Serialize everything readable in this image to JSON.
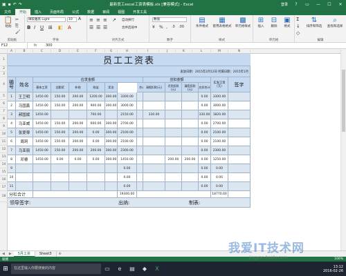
{
  "window": {
    "title": "最新员工excel工资表模板.xls [兼容模式] - Excel",
    "user": "登录",
    "buttons": [
      "?",
      "▭",
      "—",
      "☐",
      "✕"
    ]
  },
  "ribbon_tabs": [
    "文件",
    "开始",
    "插入",
    "页面布局",
    "公式",
    "数据",
    "审阅",
    "视图",
    "开发工具"
  ],
  "ribbon": {
    "font_name": "微软雅黑 Light",
    "font_size": "10",
    "number_format": "数值",
    "groups": [
      "剪贴板",
      "字体",
      "对齐方式",
      "数字",
      "样式",
      "单元格",
      "编辑"
    ],
    "buttons": {
      "paste": "粘贴",
      "wrap": "自动换行",
      "merge": "合并后居中",
      "cond_format": "条件格式",
      "as_table": "套用表格格式",
      "cell_style": "单元格样式",
      "insert": "插入",
      "delete": "删除",
      "format": "格式",
      "sort": "排序和筛选",
      "find": "查找和选择"
    }
  },
  "formula_bar": {
    "name_box": "F12",
    "fx": "fx",
    "value": "300"
  },
  "columns": [
    "A",
    "B",
    "C",
    "D",
    "E",
    "F",
    "G",
    "H",
    "I",
    "J",
    "K",
    "L",
    "M",
    "N"
  ],
  "rows": [
    "1",
    "2",
    "3",
    "4",
    "5",
    "6",
    "7",
    "8",
    "9",
    "10",
    "11",
    "12",
    "13",
    "14",
    "15",
    "16",
    "17",
    "18"
  ],
  "sheet": {
    "title": "员工工资表",
    "date_info": "发放日期：2015年2月12日 所属日期：2015年1月",
    "hdr_no": "编号",
    "hdr_name": "姓名",
    "hdr_payable": "应发金额",
    "hdr_deduct": "应扣金额",
    "hdr_actual": "实发工资（元）",
    "hdr_sign": "签字",
    "sub_payable": [
      "基本工资",
      "全勤奖",
      "补助",
      "效益",
      "奖金",
      "合计（元）"
    ],
    "sub_deduct": [
      "请假扣款(元)",
      "迟到扣款(元)",
      "漏签扣款(元)",
      "应扣合计"
    ],
    "employees": [
      {
        "no": "1",
        "name": "王卫明",
        "base": "1450.00",
        "full": "150.00",
        "sub": "200.00",
        "eff": "1200.00",
        "bonus": "300.00",
        "total": "3300.00",
        "leave": "",
        "late": "",
        "miss": "",
        "dtotal": "0.00",
        "actual": "3300.00"
      },
      {
        "no": "2",
        "name": "马国鑫",
        "base": "1450.00",
        "full": "150.00",
        "sub": "200.00",
        "eff": "900.00",
        "bonus": "300.00",
        "total": "3000.00",
        "leave": "",
        "late": "",
        "miss": "",
        "dtotal": "0.00",
        "actual": "3000.00"
      },
      {
        "no": "3",
        "name": "郝国斌",
        "base": "1450.00",
        "full": "",
        "sub": "",
        "eff": "700.00",
        "bonus": "",
        "total": "2150.00",
        "leave": "330.00",
        "late": "",
        "miss": "",
        "dtotal": "330.00",
        "actual": "1820.00"
      },
      {
        "no": "4",
        "name": "马亚威",
        "base": "1450.00",
        "full": "150.00",
        "sub": "200.00",
        "eff": "600.00",
        "bonus": "300.00",
        "total": "2700.00",
        "leave": "",
        "late": "",
        "miss": "",
        "dtotal": "0.00",
        "actual": "2700.00"
      },
      {
        "no": "5",
        "name": "张爱琴",
        "base": "1450.00",
        "full": "150.00",
        "sub": "200.00",
        "eff": "0.00",
        "bonus": "300.00",
        "total": "2100.00",
        "leave": "",
        "late": "",
        "miss": "",
        "dtotal": "0.00",
        "actual": "2100.00"
      },
      {
        "no": "6",
        "name": "周珂",
        "base": "1450.00",
        "full": "150.00",
        "sub": "200.00",
        "eff": "0.00",
        "bonus": "300.00",
        "total": "2100.00",
        "leave": "",
        "late": "",
        "miss": "",
        "dtotal": "0.00",
        "actual": "2100.00"
      },
      {
        "no": "7",
        "name": "马亚丽",
        "base": "1450.00",
        "full": "150.00",
        "sub": "200.00",
        "eff": "200.00",
        "bonus": "300.00",
        "total": "2300.00",
        "leave": "",
        "late": "",
        "miss": "",
        "dtotal": "0.00",
        "actual": "2300.00"
      },
      {
        "no": "8",
        "name": "邓睿",
        "base": "1450.00",
        "full": "0.00",
        "sub": "0.00",
        "eff": "0.00",
        "bonus": "300.00",
        "total": "1450.00",
        "leave": "",
        "late": "200.00",
        "miss": "200.00",
        "dtotal": "0.00",
        "actual": "1250.00"
      },
      {
        "no": "9",
        "name": "",
        "base": "",
        "full": "",
        "sub": "",
        "eff": "",
        "bonus": "",
        "total": "0.00",
        "leave": "",
        "late": "",
        "miss": "",
        "dtotal": "0.00",
        "actual": "0.00"
      },
      {
        "no": "10",
        "name": "",
        "base": "",
        "full": "",
        "sub": "",
        "eff": "",
        "bonus": "",
        "total": "0.00",
        "leave": "",
        "late": "",
        "miss": "",
        "dtotal": "0.00",
        "actual": "0.00"
      },
      {
        "no": "11",
        "name": "",
        "base": "",
        "full": "",
        "sub": "",
        "eff": "",
        "bonus": "",
        "total": "0.00",
        "leave": "",
        "late": "",
        "miss": "",
        "dtotal": "0.00",
        "actual": "0.00"
      }
    ],
    "subtotal_label": "分栏合计",
    "subtotal_total": "19300.00",
    "subtotal_actual": "18770.00",
    "sign_leader": "领导签字:",
    "sign_cashier": "出纳:",
    "sign_maker": "制表:"
  },
  "sheet_tabs": [
    "5月工资",
    "Sheet3"
  ],
  "status": {
    "left": "就绪",
    "zoom": "100%"
  },
  "taskbar": {
    "search": "在这里输入你要搜索的内容",
    "time": "13:12",
    "date": "2016-02-26"
  },
  "watermark": "我爱IT技术网",
  "watermark_url": "jingyan.baidu.com"
}
